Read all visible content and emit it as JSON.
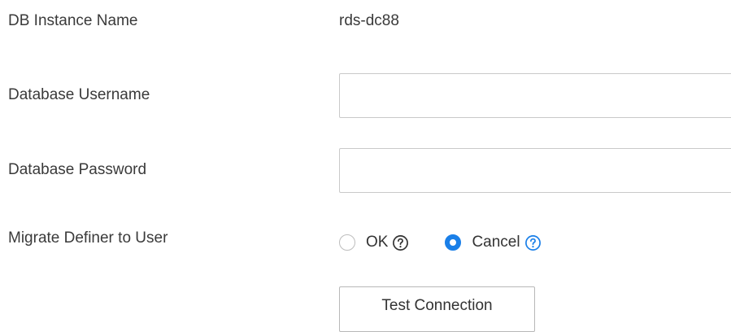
{
  "instance": {
    "label": "DB Instance Name",
    "value": "rds-dc88"
  },
  "username": {
    "label": "Database Username",
    "value": "",
    "placeholder": ""
  },
  "password": {
    "label": "Database Password",
    "value": "",
    "placeholder": ""
  },
  "definer": {
    "label": "Migrate Definer to User",
    "options": [
      {
        "label": "OK",
        "selected": false,
        "help_icon": "question-circle-icon",
        "help_color": "#333333"
      },
      {
        "label": "Cancel",
        "selected": true,
        "help_icon": "question-circle-icon",
        "help_color": "#1a7fe8"
      }
    ]
  },
  "actions": {
    "test_connection_label": "Test Connection"
  },
  "colors": {
    "accent": "#1a7fe8",
    "text": "#333333",
    "border": "#c9c9c9"
  }
}
